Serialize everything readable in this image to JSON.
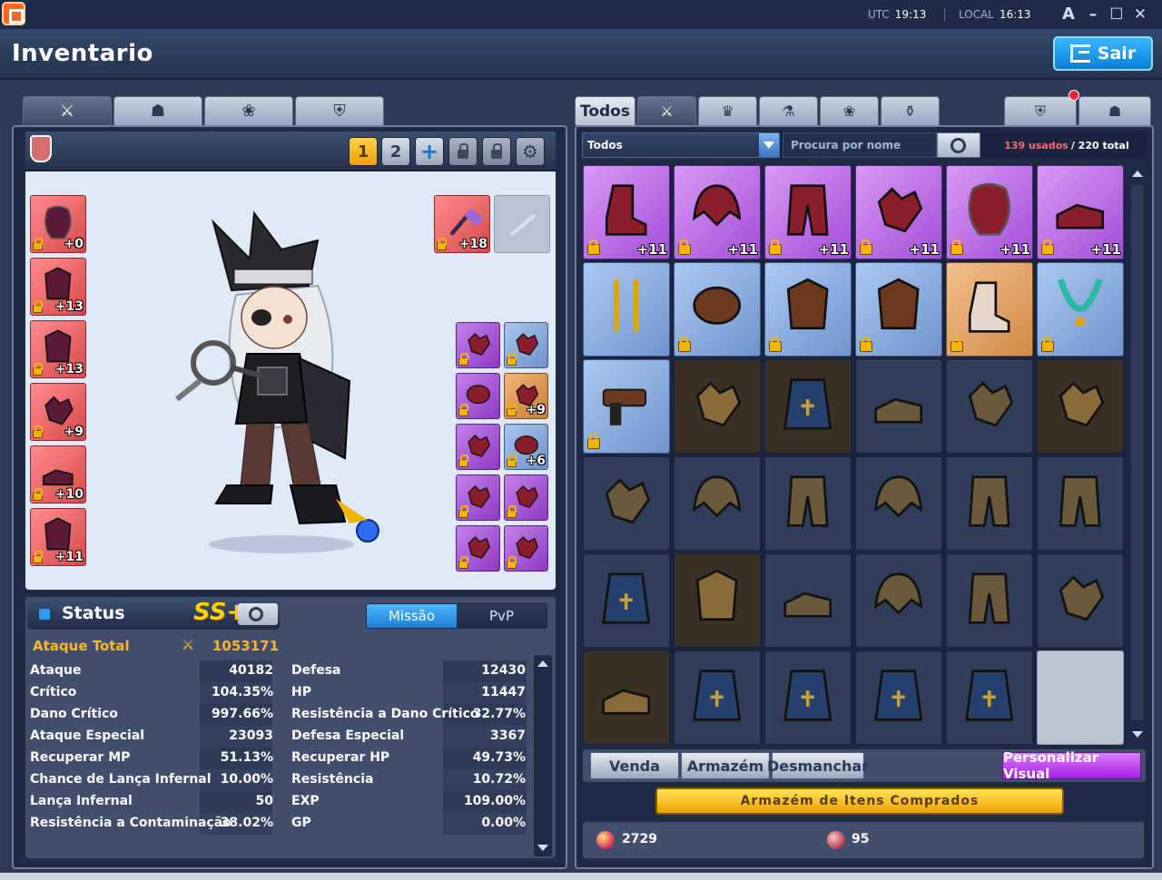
{
  "titlebar": {
    "utc_label": "UTC",
    "utc_time": "19:13",
    "local_label": "LOCAL",
    "local_time": "16:13",
    "font_button": "A"
  },
  "header": {
    "title": "Inventario",
    "exit_label": "Sair"
  },
  "equipment": {
    "presets": [
      "1",
      "2"
    ],
    "left_slots": [
      {
        "icon": "hair-costume-icon",
        "enhance": "+0",
        "color": "#d84848"
      },
      {
        "icon": "top-costume-icon",
        "enhance": "+13",
        "color": "#d84848"
      },
      {
        "icon": "bottom-costume-icon",
        "enhance": "+13",
        "color": "#d84848"
      },
      {
        "icon": "gloves-costume-icon",
        "enhance": "+9",
        "color": "#d84848"
      },
      {
        "icon": "shoes-costume-icon",
        "enhance": "+10",
        "color": "#d84848"
      },
      {
        "icon": "wings-costume-icon",
        "enhance": "+11",
        "color": "#d84848"
      }
    ],
    "weapon_slot": {
      "icon": "hammer-weapon-icon",
      "enhance": "+18"
    },
    "accessory_slots": [
      {
        "icon": "horn-accessory-icon",
        "enhance": ""
      },
      {
        "icon": "ring-accessory-icon",
        "enhance": ""
      },
      {
        "icon": "mask-accessory-icon",
        "enhance": ""
      },
      {
        "icon": "pumpkin-pet-icon",
        "enhance": "+9"
      },
      {
        "icon": "bat-wing-accessory-icon",
        "enhance": ""
      },
      {
        "icon": "orb-accessory-icon",
        "enhance": "+6"
      },
      {
        "icon": "dragon-accessory-icon",
        "enhance": ""
      },
      {
        "icon": "star-accessory-icon",
        "enhance": ""
      },
      {
        "icon": "demon-accessory-icon",
        "enhance": ""
      },
      {
        "icon": "angel-accessory-icon",
        "enhance": ""
      }
    ]
  },
  "status": {
    "title": "Status",
    "rank": "SS+",
    "modes": [
      "Missão",
      "PvP"
    ],
    "attack_total_label": "Ataque Total",
    "attack_total_value": "1053171",
    "left": [
      {
        "label": "Ataque",
        "value": "40182"
      },
      {
        "label": "Crítico",
        "value": "104.35%"
      },
      {
        "label": "Dano Crítico",
        "value": "997.66%"
      },
      {
        "label": "Ataque Especial",
        "value": "23093"
      },
      {
        "label": "Recuperar MP",
        "value": "51.13%"
      },
      {
        "label": "Chance de Lança Infernal",
        "value": "10.00%"
      },
      {
        "label": "Lança Infernal",
        "value": "50"
      },
      {
        "label": "Resistência a Contaminação",
        "value": "38.02%"
      }
    ],
    "right": [
      {
        "label": "Defesa",
        "value": "12430"
      },
      {
        "label": "HP",
        "value": "11447"
      },
      {
        "label": "Resistência a Dano Crítico",
        "value": "32.77%"
      },
      {
        "label": "Defesa Especial",
        "value": "3367"
      },
      {
        "label": "Recuperar HP",
        "value": "49.73%"
      },
      {
        "label": "Resistência",
        "value": "10.72%"
      },
      {
        "label": "EXP",
        "value": "109.00%"
      },
      {
        "label": "GP",
        "value": "0.00%"
      }
    ]
  },
  "inventory": {
    "tabs": [
      "Todos"
    ],
    "filter_value": "Todos",
    "search_placeholder": "Procura por nome",
    "used": "139 usados",
    "total": "/ 220 total",
    "items": [
      {
        "icon": "boots-costume-icon",
        "rarity": "purple",
        "enhance": "+11",
        "locked": true
      },
      {
        "icon": "helmet-costume-icon",
        "rarity": "purple",
        "enhance": "+11",
        "locked": true
      },
      {
        "icon": "pants-costume-icon",
        "rarity": "purple",
        "enhance": "+11",
        "locked": true
      },
      {
        "icon": "gloves-costume-icon",
        "rarity": "purple",
        "enhance": "+11",
        "locked": true
      },
      {
        "icon": "hair-costume-icon",
        "rarity": "purple",
        "enhance": "+11",
        "locked": true
      },
      {
        "icon": "shoes-costume-icon",
        "rarity": "purple",
        "enhance": "+11",
        "locked": true
      },
      {
        "icon": "staff-icon",
        "rarity": "blue",
        "enhance": "",
        "locked": false
      },
      {
        "icon": "mask-icon",
        "rarity": "blue",
        "enhance": "",
        "locked": true
      },
      {
        "icon": "sneakers-icon",
        "rarity": "blue",
        "enhance": "",
        "locked": true
      },
      {
        "icon": "gauntlet-icon",
        "rarity": "blue",
        "enhance": "",
        "locked": true
      },
      {
        "icon": "boots-icon",
        "rarity": "orange",
        "enhance": "",
        "locked": true
      },
      {
        "icon": "necklace-icon",
        "rarity": "blue",
        "enhance": "",
        "locked": true
      },
      {
        "icon": "gun-icon",
        "rarity": "blue",
        "enhance": "",
        "locked": true
      },
      {
        "icon": "gloves-icon",
        "rarity": "brown",
        "enhance": "",
        "locked": false
      },
      {
        "icon": "cape-icon",
        "rarity": "brown",
        "enhance": "",
        "locked": false
      },
      {
        "icon": "shoes-icon",
        "rarity": "dark",
        "enhance": "",
        "locked": false
      },
      {
        "icon": "gloves-icon",
        "rarity": "dark",
        "enhance": "",
        "locked": false
      },
      {
        "icon": "gloves-icon",
        "rarity": "brown",
        "enhance": "",
        "locked": false
      },
      {
        "icon": "gloves-icon",
        "rarity": "dark",
        "enhance": "",
        "locked": false
      },
      {
        "icon": "helmet-icon",
        "rarity": "dark",
        "enhance": "",
        "locked": false
      },
      {
        "icon": "pants-icon",
        "rarity": "dark",
        "enhance": "",
        "locked": false
      },
      {
        "icon": "helmet-icon",
        "rarity": "dark",
        "enhance": "",
        "locked": false
      },
      {
        "icon": "pants-icon",
        "rarity": "dark",
        "enhance": "",
        "locked": false
      },
      {
        "icon": "pants-icon",
        "rarity": "dark",
        "enhance": "",
        "locked": false
      },
      {
        "icon": "cape-icon",
        "rarity": "dark",
        "enhance": "",
        "locked": false
      },
      {
        "icon": "armor-icon",
        "rarity": "brown",
        "enhance": "",
        "locked": false
      },
      {
        "icon": "shoes-icon",
        "rarity": "dark",
        "enhance": "",
        "locked": false
      },
      {
        "icon": "helmet-icon",
        "rarity": "dark",
        "enhance": "",
        "locked": false
      },
      {
        "icon": "pants-icon",
        "rarity": "dark",
        "enhance": "",
        "locked": false
      },
      {
        "icon": "gloves-icon",
        "rarity": "dark",
        "enhance": "",
        "locked": false
      },
      {
        "icon": "shoes-icon",
        "rarity": "brown",
        "enhance": "",
        "locked": false
      },
      {
        "icon": "cape-icon",
        "rarity": "dark",
        "enhance": "",
        "locked": false
      },
      {
        "icon": "cape-icon",
        "rarity": "dark",
        "enhance": "",
        "locked": false
      },
      {
        "icon": "cape-icon",
        "rarity": "dark",
        "enhance": "",
        "locked": false
      },
      {
        "icon": "cape-icon",
        "rarity": "dark",
        "enhance": "",
        "locked": false
      },
      {
        "icon": "",
        "rarity": "empty",
        "enhance": "",
        "locked": false
      }
    ],
    "actions": {
      "venda": "Venda",
      "armazem": "Armazém",
      "desmanchar": "Desmanchar",
      "personalizar": "Personalizar Visual"
    },
    "bought_items": "Armazém de Itens Comprados",
    "currency": [
      {
        "icon": "gem-coin-icon",
        "value": "2729"
      },
      {
        "icon": "ticket-coin-icon",
        "value": "95"
      }
    ]
  }
}
